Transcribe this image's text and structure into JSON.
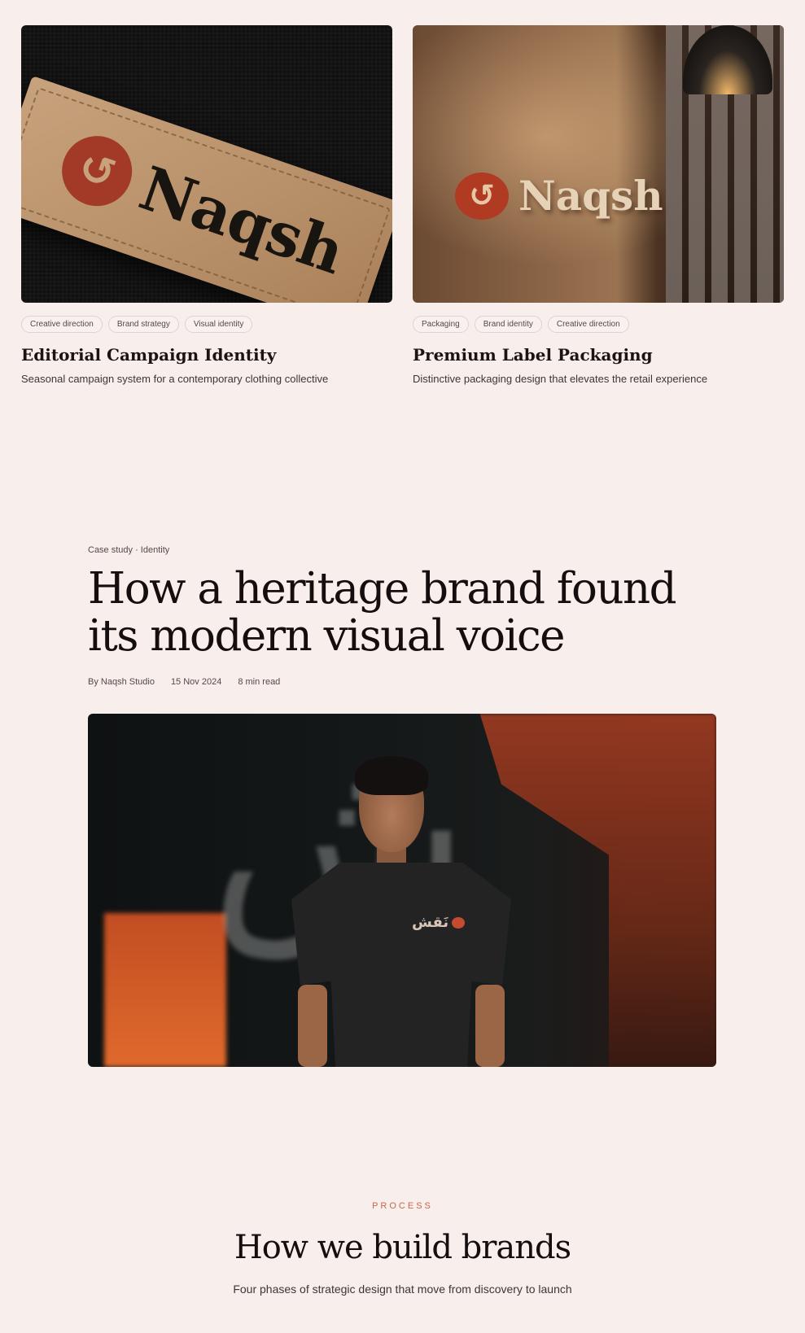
{
  "cards": [
    {
      "tags": [
        "Creative direction",
        "Brand strategy",
        "Visual identity"
      ],
      "title": "Editorial Campaign Identity",
      "description": "Seasonal campaign system for a contemporary clothing collective",
      "image_text": "Naqsh"
    },
    {
      "tags": [
        "Packaging",
        "Brand identity",
        "Creative direction"
      ],
      "title": "Premium Label Packaging",
      "description": "Distinctive packaging design that elevates the retail experience",
      "image_text": "Naqsh"
    }
  ],
  "article": {
    "kicker": "Case study · Identity",
    "headline": "How a heritage brand found its modern visual voice",
    "author": "By Naqsh Studio",
    "date": "15 Nov 2024",
    "read_time": "8 min read",
    "hero_shirt_text": "نَقش"
  },
  "process": {
    "kicker": "PROCESS",
    "title": "How we build brands",
    "description": "Four phases of strategic design that move from discovery to launch"
  },
  "colors": {
    "background": "#f8eeec",
    "accent": "#c46a4a",
    "text": "#1a1514"
  }
}
